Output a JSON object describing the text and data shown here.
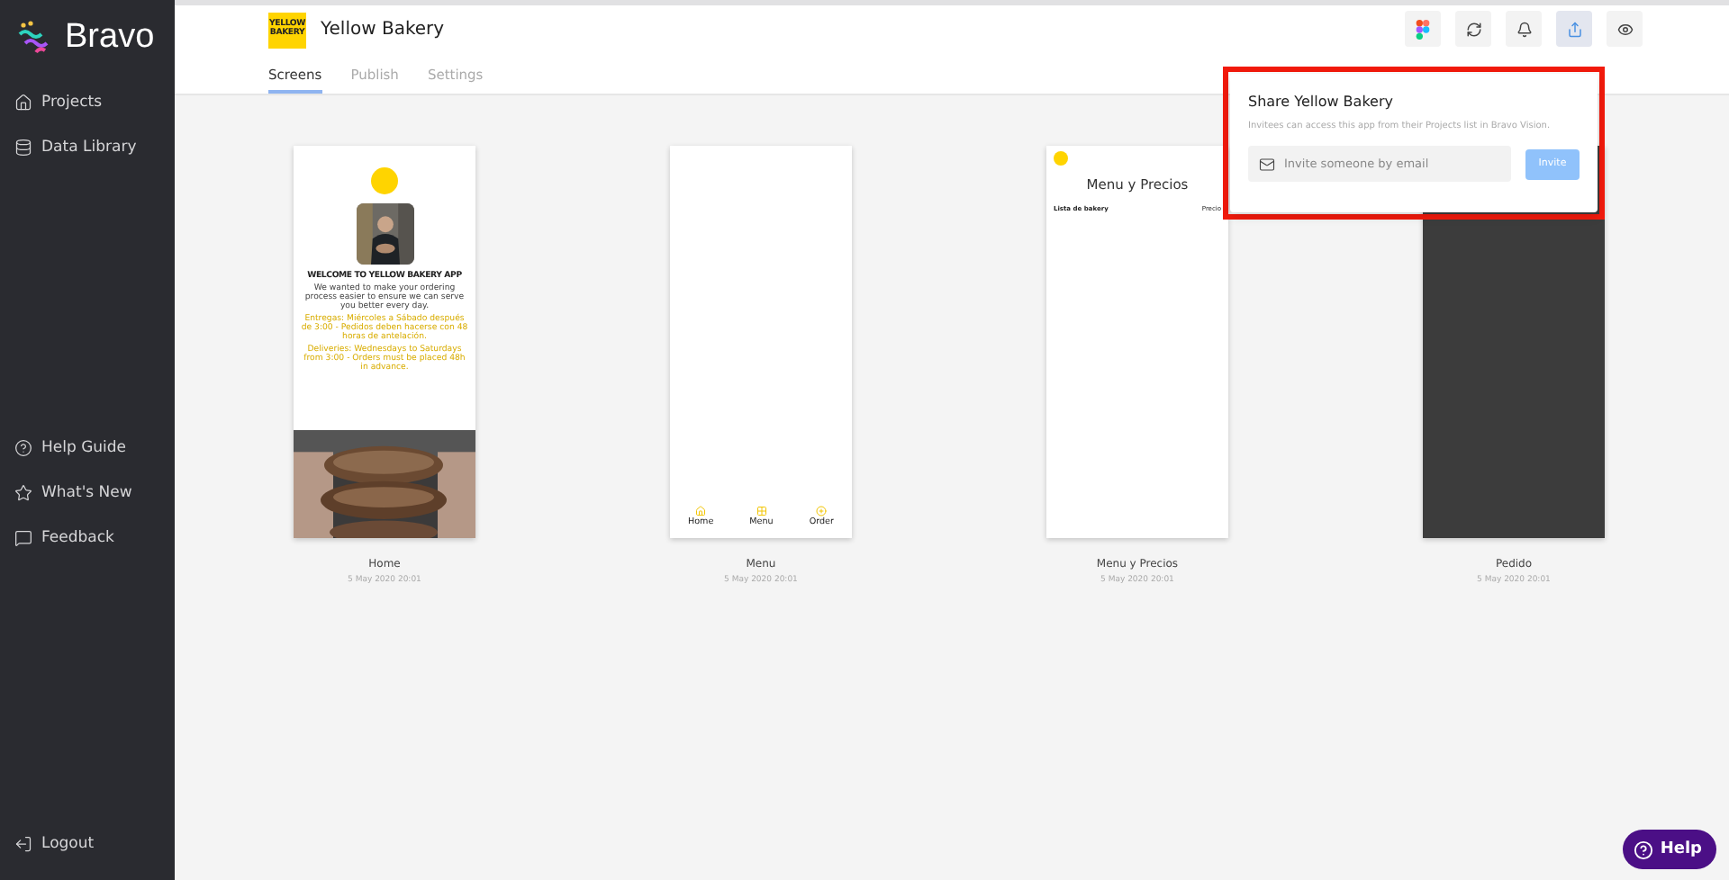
{
  "sidebar": {
    "brand": "Bravo",
    "items": [
      {
        "label": "Projects"
      },
      {
        "label": "Data Library"
      }
    ],
    "footer_items": [
      {
        "label": "Help Guide"
      },
      {
        "label": "What's New"
      },
      {
        "label": "Feedback"
      }
    ],
    "logout": "Logout"
  },
  "header": {
    "logo_text": "YELLOW BAKERY",
    "project_name": "Yellow Bakery",
    "tabs": [
      {
        "label": "Screens",
        "selected": true
      },
      {
        "label": "Publish",
        "selected": false
      },
      {
        "label": "Settings",
        "selected": false
      }
    ],
    "actions": [
      {
        "selected": false
      },
      {
        "selected": false
      },
      {
        "selected": false
      },
      {
        "selected": true
      },
      {
        "selected": false
      }
    ]
  },
  "screens": [
    {
      "kind": "home",
      "title": "Home",
      "date": "5 May 2020 20:01",
      "heading": "WELCOME TO YELLOW BAKERY APP",
      "body": "We wanted to make your ordering process easier to ensure we can serve you better every day.",
      "notes": [
        "Entregas: Miércoles a Sábado después de 3:00 - Pedidos deben hacerse con 48 horas de antelación.",
        "Deliveries: Wednesdays to Saturdays from 3:00 - Orders must be placed 48h in advance."
      ]
    },
    {
      "kind": "menu",
      "title": "Menu",
      "date": "5 May 2020 20:01",
      "nav": [
        "Home",
        "Menu",
        "Order"
      ]
    },
    {
      "kind": "price_list",
      "title": "Menu y Precios",
      "date": "5 May 2020 20:01",
      "heading": "Menu y Precios",
      "column_1": "Lista de bakery",
      "column_2": "Precio"
    },
    {
      "kind": "dark",
      "title": "Pedido",
      "date": "5 May 2020 20:01"
    }
  ],
  "share_popover": {
    "title": "Share Yellow Bakery",
    "description": "Invitees can access this app from their Projects list in Bravo Vision.",
    "placeholder": "Invite someone by email",
    "button": {
      "label": "Invite",
      "disabled": true
    }
  },
  "help_button": "Help"
}
